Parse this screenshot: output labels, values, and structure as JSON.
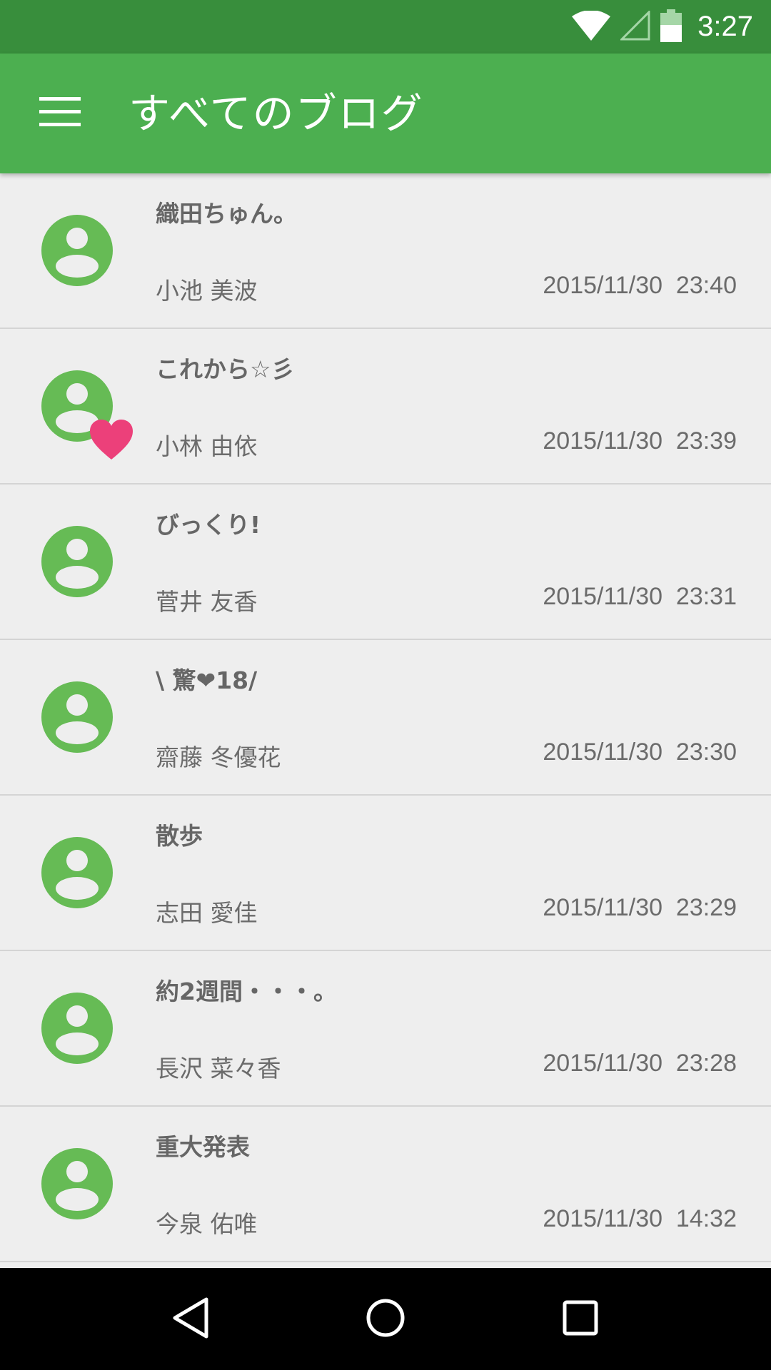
{
  "status_bar": {
    "time": "3:27",
    "icons": [
      "wifi-icon",
      "cell-signal-icon",
      "battery-icon"
    ]
  },
  "app_bar": {
    "menu_icon": "hamburger-menu-icon",
    "title": "すべてのブログ"
  },
  "colors": {
    "status_bar": "#388e3c",
    "app_bar": "#4caf50",
    "avatar": "#66bb55",
    "heart": "#ec407a",
    "background": "#eeeeee"
  },
  "posts": [
    {
      "title": "織田ちゅん。",
      "author": "小池 美波",
      "date": "2015/11/30  23:40",
      "favorite": false
    },
    {
      "title": "これから☆彡",
      "author": "小林 由依",
      "date": "2015/11/30  23:39",
      "favorite": true
    },
    {
      "title": "びっくり!",
      "author": "菅井 友香",
      "date": "2015/11/30  23:31",
      "favorite": false
    },
    {
      "title": "\\ 驚❤18/",
      "author": "齋藤 冬優花",
      "date": "2015/11/30  23:30",
      "favorite": false
    },
    {
      "title": "散歩",
      "author": "志田 愛佳",
      "date": "2015/11/30  23:29",
      "favorite": false
    },
    {
      "title": "約2週間・・・。",
      "author": "長沢 菜々香",
      "date": "2015/11/30  23:28",
      "favorite": false
    },
    {
      "title": "重大発表",
      "author": "今泉 佑唯",
      "date": "2015/11/30  14:32",
      "favorite": false
    }
  ],
  "nav_bar": {
    "icons": [
      "back-icon",
      "home-icon",
      "recents-icon"
    ]
  }
}
